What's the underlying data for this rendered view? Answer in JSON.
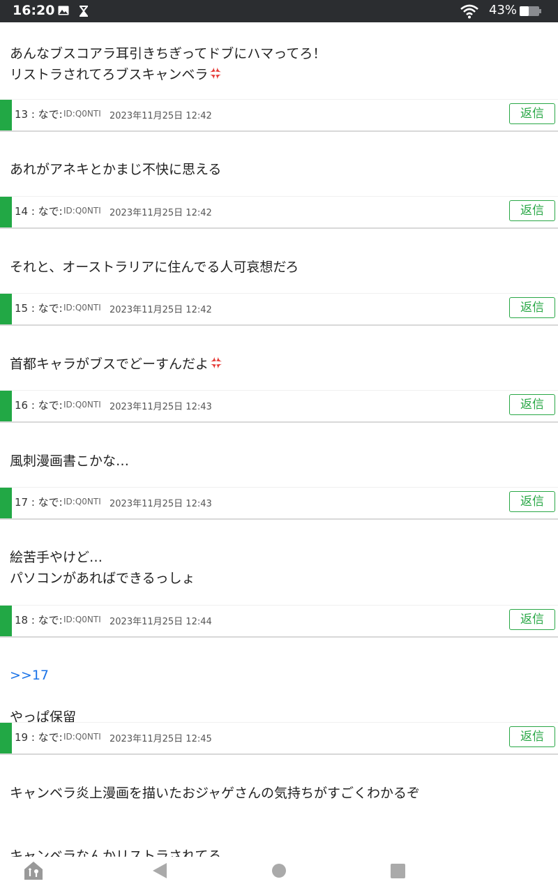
{
  "status_bar": {
    "time": "16:20",
    "battery_percent": "43%",
    "icons": [
      "image-icon",
      "hourglass-icon",
      "wifi-icon",
      "battery-icon"
    ]
  },
  "thread": {
    "reply_label": "返信",
    "top_post_body": "あんなブスコアラ耳引きちぎってドブにハマってろ！\nリストラされてろブスキャンベラ",
    "posts": [
      {
        "header": "13 : なで:",
        "id": "ID:Q0NTI",
        "date": "2023年11月25日 12:42",
        "body": "あれがアネキとかまじ不快に思える",
        "ref": ""
      },
      {
        "header": "14 : なで:",
        "id": "ID:Q0NTI",
        "date": "2023年11月25日 12:42",
        "body": "それと、オーストラリアに住んでる人可哀想だろ",
        "ref": ""
      },
      {
        "header": "15 : なで:",
        "id": "ID:Q0NTI",
        "date": "2023年11月25日 12:42",
        "body": "首都キャラがブスでどーすんだよ",
        "ref": ""
      },
      {
        "header": "16 : なで:",
        "id": "ID:Q0NTI",
        "date": "2023年11月25日 12:43",
        "body": "風刺漫画書こかな…",
        "ref": ""
      },
      {
        "header": "17 : なで:",
        "id": "ID:Q0NTI",
        "date": "2023年11月25日 12:43",
        "body": "絵苦手やけど…\nパソコンがあればできるっしょ",
        "ref": ""
      },
      {
        "header": "18 : なで:",
        "id": "ID:Q0NTI",
        "date": "2023年11月25日 12:44",
        "body": "やっぱ保留",
        "ref": ">>17"
      },
      {
        "header": "19 : なで:",
        "id": "ID:Q0NTI",
        "date": "2023年11月25日 12:45",
        "body": "キャンベラ炎上漫画を描いたおジャゲさんの気持ちがすごくわかるぞ\n\n\nキャンベラなんかリストラされてろ",
        "ref": ""
      }
    ]
  },
  "nav_bar": {
    "icons": [
      "home-icon",
      "back-icon",
      "home-circle-icon",
      "recents-icon"
    ]
  },
  "colors": {
    "accent_green": "#22a845",
    "link_blue": "#1a73e8",
    "status_bar_bg": "#2b2d30"
  }
}
